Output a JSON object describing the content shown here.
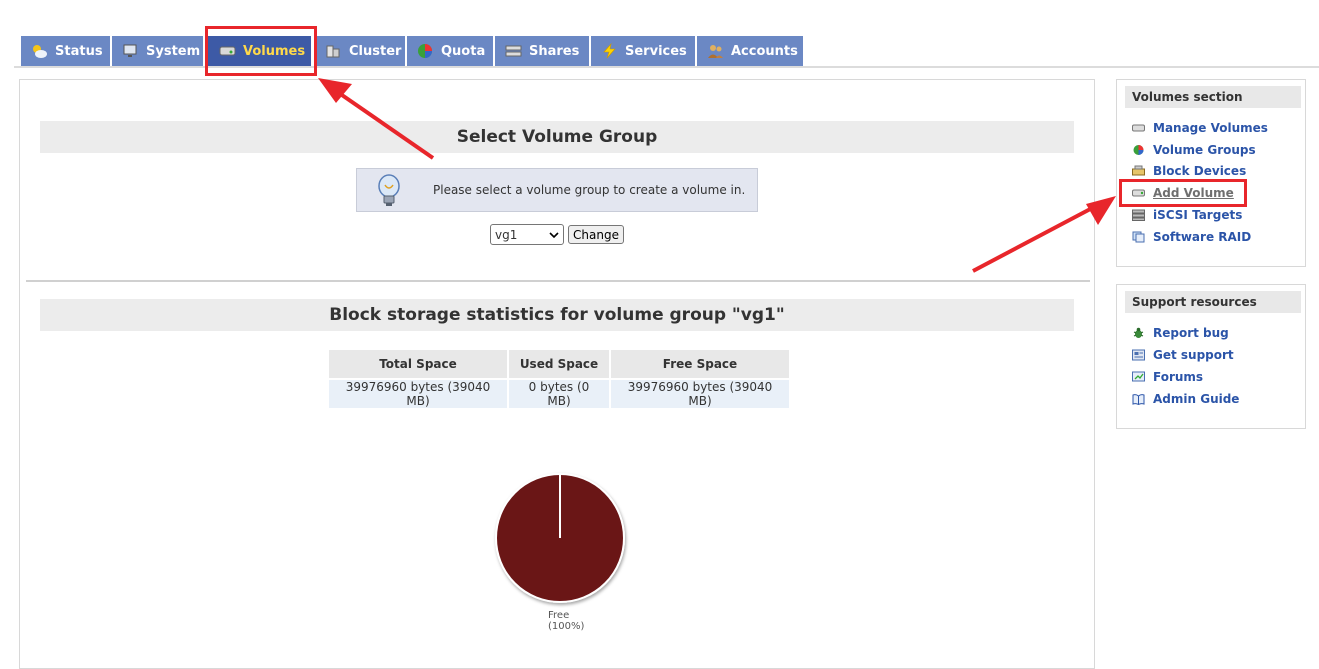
{
  "tabs": [
    {
      "label": "Status",
      "icon": "status-icon",
      "active": false
    },
    {
      "label": "System",
      "icon": "system-icon",
      "active": false
    },
    {
      "label": "Volumes",
      "icon": "volumes-icon",
      "active": true
    },
    {
      "label": "Cluster",
      "icon": "cluster-icon",
      "active": false
    },
    {
      "label": "Quota",
      "icon": "quota-icon",
      "active": false
    },
    {
      "label": "Shares",
      "icon": "shares-icon",
      "active": false
    },
    {
      "label": "Services",
      "icon": "services-icon",
      "active": false
    },
    {
      "label": "Accounts",
      "icon": "accounts-icon",
      "active": false
    }
  ],
  "main": {
    "select_title": "Select Volume Group",
    "info_text": "Please select a volume group to create a volume in.",
    "select_value": "vg1",
    "change_label": "Change",
    "stats_title": "Block storage statistics for volume group \"vg1\"",
    "table": {
      "headers": [
        "Total Space",
        "Used Space",
        "Free Space"
      ],
      "row": [
        "39976960 bytes (39040 MB)",
        "0 bytes (0 MB)",
        "39976960 bytes (39040 MB)"
      ]
    },
    "pie": {
      "label_line1": "Free",
      "label_line2": "(100%)",
      "color": "#6b1619"
    }
  },
  "chart_data": {
    "type": "pie",
    "categories": [
      "Free"
    ],
    "values": [
      100
    ]
  },
  "volumes_section": {
    "title": "Volumes section",
    "items": [
      {
        "label": "Manage Volumes",
        "icon": "manage-volumes-icon"
      },
      {
        "label": "Volume Groups",
        "icon": "volume-groups-icon"
      },
      {
        "label": "Block Devices",
        "icon": "block-devices-icon"
      },
      {
        "label": "Add Volume",
        "icon": "add-volume-icon"
      },
      {
        "label": "iSCSI Targets",
        "icon": "iscsi-targets-icon"
      },
      {
        "label": "Software RAID",
        "icon": "software-raid-icon"
      }
    ]
  },
  "support_section": {
    "title": "Support resources",
    "items": [
      {
        "label": "Report bug",
        "icon": "bug-icon"
      },
      {
        "label": "Get support",
        "icon": "support-icon"
      },
      {
        "label": "Forums",
        "icon": "forums-icon"
      },
      {
        "label": "Admin Guide",
        "icon": "admin-guide-icon"
      }
    ]
  },
  "colors": {
    "tab": "#6b88c4",
    "tab_active": "#3d5aa6",
    "tab_active_text": "#ffd94a",
    "link": "#2b54a8",
    "annotation": "#e8262b"
  }
}
